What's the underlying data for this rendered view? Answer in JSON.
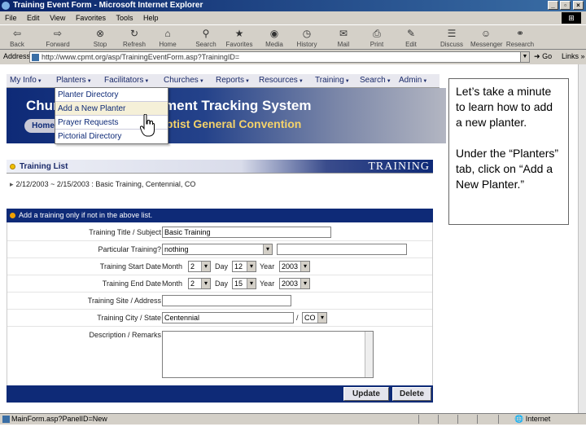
{
  "window": {
    "title": "Training Event Form - Microsoft Internet Explorer",
    "controls": [
      "_",
      "▫",
      "×"
    ]
  },
  "menubar": [
    "File",
    "Edit",
    "View",
    "Favorites",
    "Tools",
    "Help"
  ],
  "toolbar": [
    {
      "label": "Back",
      "icon": "back-arrow-icon"
    },
    {
      "label": "Forward",
      "icon": "forward-arrow-icon"
    },
    {
      "label": "Stop",
      "icon": "stop-icon"
    },
    {
      "label": "Refresh",
      "icon": "refresh-icon"
    },
    {
      "label": "Home",
      "icon": "home-icon"
    },
    {
      "label": "Search",
      "icon": "search-icon"
    },
    {
      "label": "Favorites",
      "icon": "favorites-icon"
    },
    {
      "label": "Media",
      "icon": "media-icon"
    },
    {
      "label": "History",
      "icon": "history-icon"
    },
    {
      "label": "Mail",
      "icon": "mail-icon"
    },
    {
      "label": "Print",
      "icon": "print-icon"
    },
    {
      "label": "Edit",
      "icon": "edit-icon"
    },
    {
      "label": "Discuss",
      "icon": "discuss-icon"
    },
    {
      "label": "Messenger",
      "icon": "messenger-icon"
    },
    {
      "label": "Research",
      "icon": "research-icon"
    }
  ],
  "address": {
    "label": "Address",
    "url": "http://www.cpmt.org/asp/TrainingEventForm.asp?TrainingID=",
    "go": "Go",
    "links": "Links »"
  },
  "nav": [
    "My Info",
    "Planters",
    "Facilitators",
    "Churches",
    "Reports",
    "Resources",
    "Training",
    "Search",
    "Admin"
  ],
  "banner": {
    "title": "Church Planter Movement Tracking System",
    "subtitle": "Baptist General Convention",
    "home": "Home"
  },
  "dropdown": [
    "Planter Directory",
    "Add a New Planter",
    "Prayer Requests",
    "Pictorial Directory"
  ],
  "note": {
    "p1": "Let’s take a minute to learn how to add a new planter.",
    "p2": "Under the “Planters” tab, click on “Add a New Planter.”"
  },
  "training_list": {
    "title": "Training List",
    "brand": "TRAINING",
    "entry": "2/12/2003 ~ 2/15/2003 : Basic Training, Centennial, CO"
  },
  "section_header": "Add a training only if not in the above list.",
  "form": {
    "title_label": "Training Title / Subject",
    "title_value": "Basic Training",
    "particular_label": "Particular Training?",
    "particular_value": "nothing",
    "start_label": "Training Start Date",
    "end_label": "Training End Date",
    "month_label": "Month",
    "day_label": "Day",
    "year_label": "Year",
    "start_month": "2",
    "start_day": "12",
    "start_year": "2003",
    "end_month": "2",
    "end_day": "15",
    "end_year": "2003",
    "site_label": "Training Site / Address",
    "city_label": "Training City / State",
    "city_value": "Centennial",
    "slash": "/",
    "state_value": "CO",
    "desc_label": "Description / Remarks",
    "update": "Update",
    "delete": "Delete"
  },
  "status": {
    "text": "MainForm.asp?PanelID=New",
    "zone": "Internet"
  }
}
